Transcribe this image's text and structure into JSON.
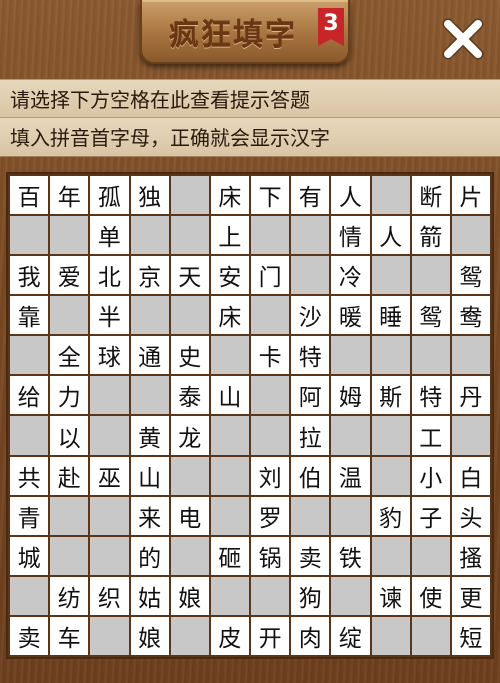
{
  "header": {
    "title": "疯狂填字",
    "level": "3",
    "close_icon": "close-icon"
  },
  "hints": {
    "line1": "请选择下方空格在此查看提示答题",
    "line2": "填入拼音首字母，正确就会显示汉字"
  },
  "colors": {
    "wood": "#7a4a24",
    "badge": "#c8252a",
    "empty_cell": "#c8c8c8",
    "filled_cell": "#ffffff"
  },
  "grid": [
    [
      "百",
      "年",
      "孤",
      "独",
      "",
      "床",
      "下",
      "有",
      "人",
      "",
      "断",
      "片"
    ],
    [
      "",
      "",
      "单",
      "",
      "",
      "上",
      "",
      "",
      "情",
      "人",
      "箭",
      ""
    ],
    [
      "我",
      "爱",
      "北",
      "京",
      "天",
      "安",
      "门",
      "",
      "冷",
      "",
      "",
      "鸳"
    ],
    [
      "靠",
      "",
      "半",
      "",
      "",
      "床",
      "",
      "沙",
      "暖",
      "睡",
      "鸳",
      "鸯"
    ],
    [
      "",
      "全",
      "球",
      "通",
      "史",
      "",
      "卡",
      "特",
      "",
      "",
      "",
      ""
    ],
    [
      "给",
      "力",
      "",
      "",
      "泰",
      "山",
      "",
      "阿",
      "姆",
      "斯",
      "特",
      "丹"
    ],
    [
      "",
      "以",
      "",
      "黄",
      "龙",
      "",
      "",
      "拉",
      "",
      "",
      "工",
      ""
    ],
    [
      "共",
      "赴",
      "巫",
      "山",
      "",
      "",
      "刘",
      "伯",
      "温",
      "",
      "小",
      "白"
    ],
    [
      "青",
      "",
      "",
      "来",
      "电",
      "",
      "罗",
      "",
      "",
      "豹",
      "子",
      "头"
    ],
    [
      "城",
      "",
      "",
      "的",
      "",
      "砸",
      "锅",
      "卖",
      "铁",
      "",
      "",
      "搔"
    ],
    [
      "",
      "纺",
      "织",
      "姑",
      "娘",
      "",
      "",
      "狗",
      "",
      "谏",
      "使",
      "更"
    ],
    [
      "卖",
      "车",
      "",
      "娘",
      "",
      "皮",
      "开",
      "肉",
      "绽",
      "",
      "",
      "短"
    ]
  ]
}
